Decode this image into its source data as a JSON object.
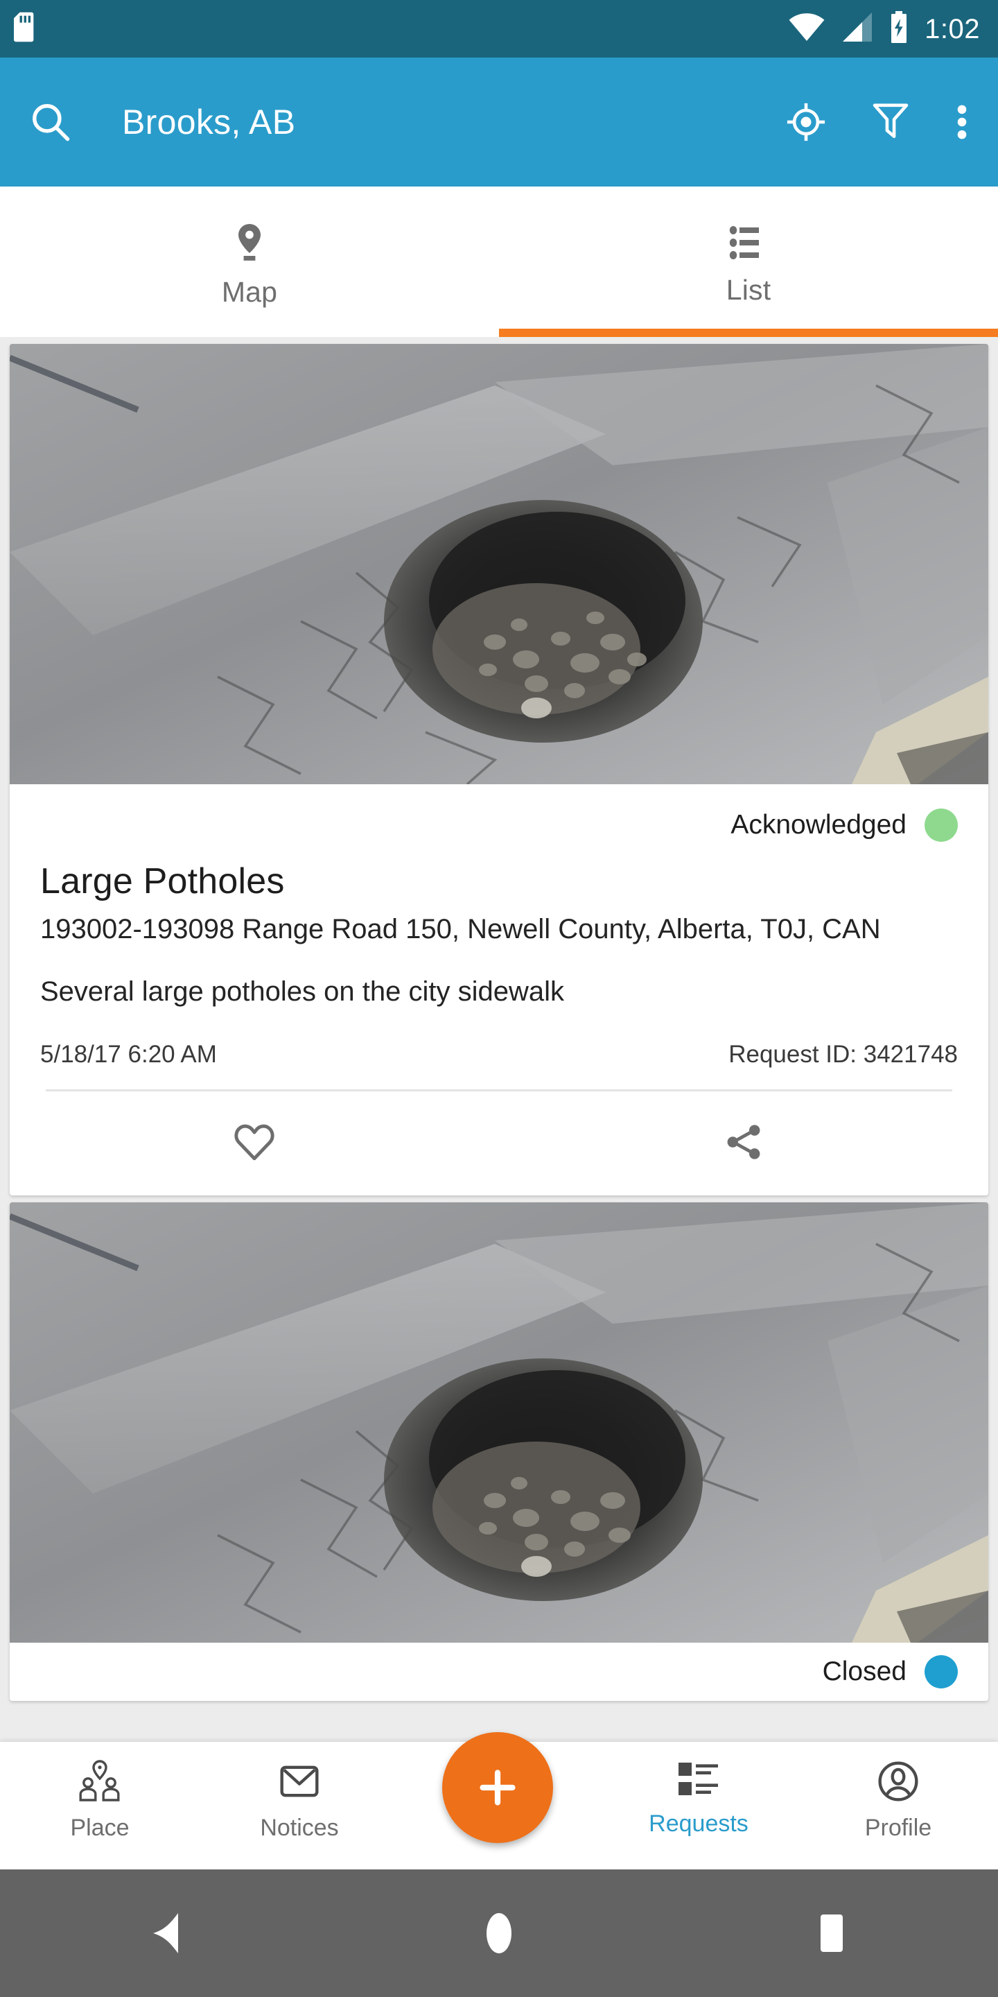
{
  "status_bar": {
    "time": "1:02",
    "icons": [
      "sd-card-icon",
      "wifi-icon",
      "cell-signal-icon",
      "battery-charging-icon"
    ]
  },
  "app_bar": {
    "title": "Brooks, AB",
    "search_icon": "search-icon",
    "my_location_icon": "my-location-icon",
    "filter_icon": "filter-icon",
    "overflow_icon": "overflow-menu-icon"
  },
  "tabs": [
    {
      "label": "Map",
      "icon": "map-pin-icon",
      "active": false
    },
    {
      "label": "List",
      "icon": "list-icon",
      "active": true
    }
  ],
  "colors": {
    "status_bar": "#1A657C",
    "app_bar": "#2A9CCB",
    "accent_orange": "#F57C20",
    "fab_orange": "#EE7019",
    "active_blue": "#2A9CCB",
    "status_acknowledged": "#8ED98E",
    "status_closed": "#1F9FD0"
  },
  "requests": [
    {
      "status": "Acknowledged",
      "status_color": "#8ED98E",
      "title": "Large Potholes",
      "address": "193002-193098 Range Road 150, Newell County, Alberta, T0J, CAN",
      "description": "Several large potholes on the city sidewalk",
      "date": "5/18/17 6:20 AM",
      "request_id": "Request ID: 3421748",
      "favorite_icon": "heart-icon",
      "share_icon": "share-icon",
      "photo_alt": "pothole-photo"
    },
    {
      "status": "Closed",
      "status_color": "#1F9FD0",
      "photo_alt": "pothole-photo"
    }
  ],
  "bottom_nav": [
    {
      "label": "Place",
      "icon": "place-people-icon",
      "active": false
    },
    {
      "label": "Notices",
      "icon": "envelope-icon",
      "active": false
    },
    {
      "label": "Requests",
      "icon": "requests-list-icon",
      "active": true
    },
    {
      "label": "Profile",
      "icon": "account-circle-icon",
      "active": false
    }
  ],
  "fab": {
    "icon": "plus-icon",
    "label": "+"
  },
  "android_nav": {
    "back": "back-triangle-icon",
    "home": "home-circle-icon",
    "recents": "recents-square-icon"
  }
}
